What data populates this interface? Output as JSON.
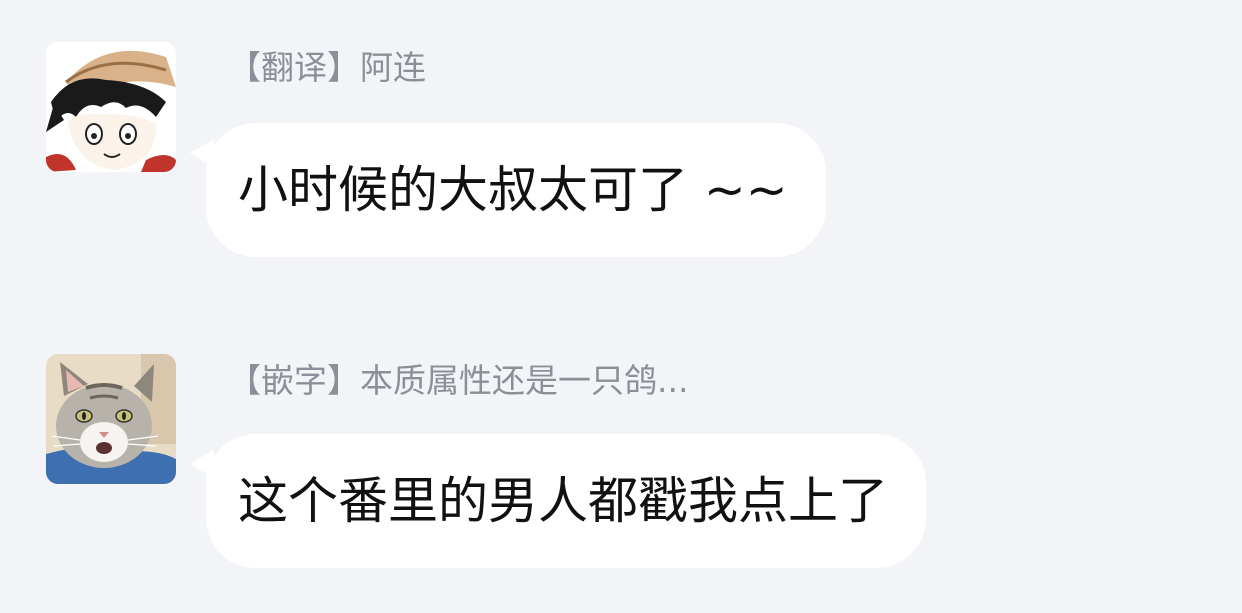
{
  "messages": [
    {
      "sender": "【翻译】阿连",
      "text": "小时候的大叔太可了 ~~",
      "avatar_icon": "anime-boy-avatar-icon"
    },
    {
      "sender": "【嵌字】本质属性还是一只鸽...",
      "text": "这个番里的男人都戳我点上了",
      "avatar_icon": "cat-avatar-icon"
    }
  ]
}
